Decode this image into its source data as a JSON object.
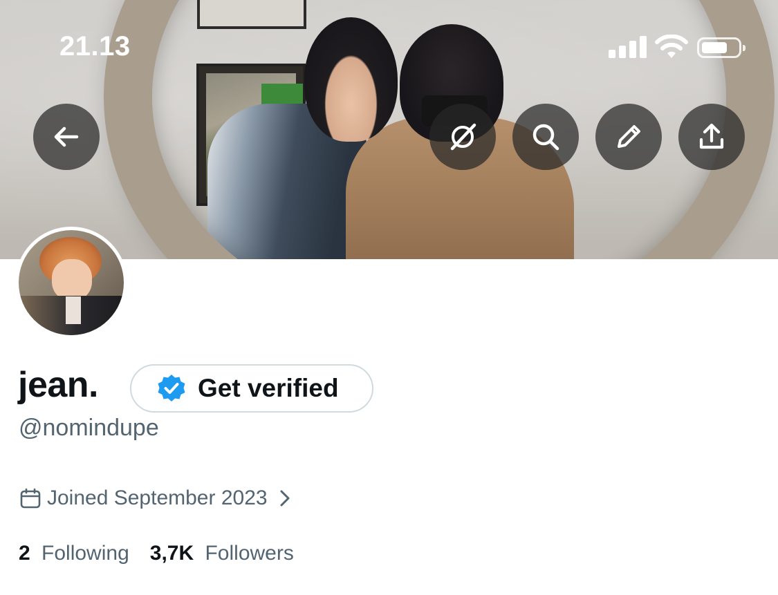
{
  "status_bar": {
    "time": "21.13",
    "signal_icon": "cellular-signal-icon",
    "wifi_icon": "wifi-icon",
    "battery_icon": "battery-icon"
  },
  "header": {
    "banner_image": "header-banner-photo",
    "buttons": [
      {
        "name": "back-button",
        "icon": "arrow-left-icon"
      },
      {
        "name": "grok-button",
        "icon": "grok-icon"
      },
      {
        "name": "search-button",
        "icon": "search-icon"
      },
      {
        "name": "edit-button",
        "icon": "pencil-icon"
      },
      {
        "name": "share-button",
        "icon": "share-upload-icon"
      }
    ]
  },
  "profile": {
    "avatar_image": "profile-avatar-photo",
    "display_name": "jean.",
    "verify_button_label": "Get verified",
    "verify_icon": "verified-badge-icon",
    "handle": "@nomindupe",
    "joined": "Joined September 2023",
    "following_count": "2",
    "following_label": "Following",
    "followers_count": "3,7K",
    "followers_label": "Followers"
  },
  "colors": {
    "text_primary": "#0f1419",
    "text_secondary": "#536471",
    "verified_blue": "#1d9bf0",
    "button_border": "#cfd9de",
    "overlay_button": "#282828"
  }
}
